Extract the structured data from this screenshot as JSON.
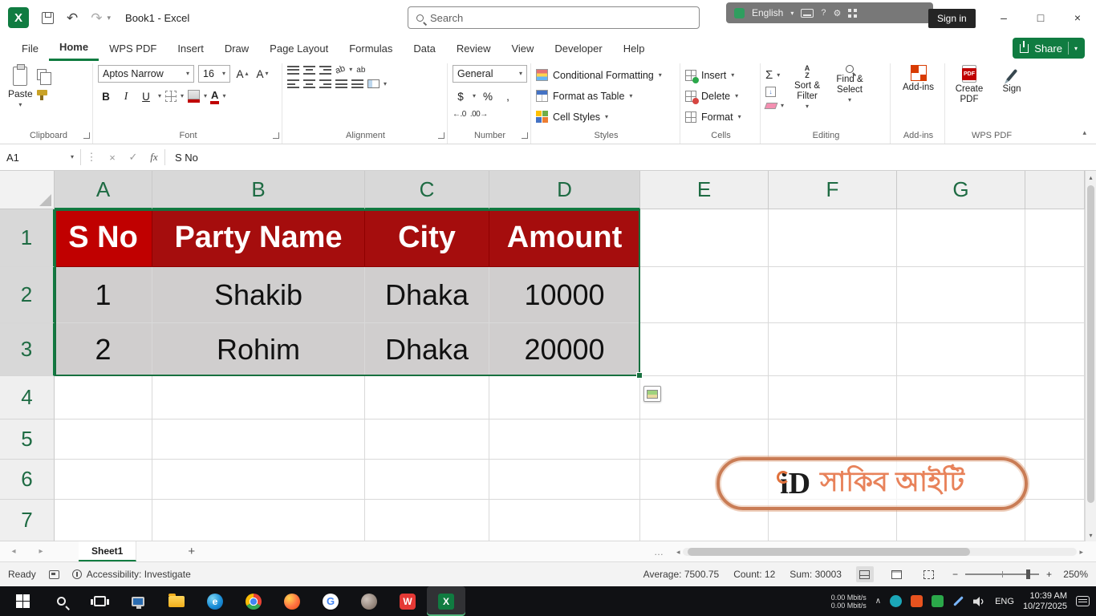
{
  "titlebar": {
    "app_title": "Book1 - Excel",
    "search_placeholder": "Search",
    "sign_in_label": "Sign in",
    "language_label": "English"
  },
  "icons": {
    "excel_logo": "X",
    "wps_logo": "W",
    "google_logo": "G",
    "edge_logo": "e",
    "dropdown": "▾",
    "undo": "↶",
    "redo": "↷",
    "minimize": "–",
    "maximize": "□",
    "close": "×",
    "sum": "Σ",
    "currency": "$",
    "percent": "%",
    "comma": ",",
    "letter_a": "A",
    "letter_z": "Z",
    "arrow_down": "↓",
    "check": "✓",
    "cancel": "×",
    "kebab": "⋮",
    "ellipsis": "…",
    "nav_left": "◂",
    "nav_right": "▸",
    "scroll_up": "▴",
    "scroll_down": "▾",
    "zoom_in": "+",
    "zoom_out": "−",
    "help": "?",
    "gear": "⚙",
    "tray_chevron": "∧",
    "inc_decimal": "←.0",
    "dec_decimal": ".00→",
    "pdf_label": "PDF",
    "plus": "+",
    "ab": "ab"
  },
  "ribbon_tabs": {
    "file": "File",
    "home": "Home",
    "wps_pdf": "WPS PDF",
    "insert": "Insert",
    "draw": "Draw",
    "page_layout": "Page Layout",
    "formulas": "Formulas",
    "data": "Data",
    "review": "Review",
    "view": "View",
    "developer": "Developer",
    "help": "Help",
    "share": "Share"
  },
  "ribbon": {
    "clipboard": {
      "paste": "Paste",
      "group": "Clipboard"
    },
    "font": {
      "family": "Aptos Narrow",
      "size": "16",
      "bold": "B",
      "italic": "I",
      "underline": "U",
      "group": "Font"
    },
    "alignment": {
      "group": "Alignment"
    },
    "number": {
      "format": "General",
      "group": "Number"
    },
    "styles": {
      "conditional_formatting": "Conditional Formatting",
      "format_as_table": "Format as Table",
      "cell_styles": "Cell Styles",
      "group": "Styles"
    },
    "cells": {
      "insert": "Insert",
      "delete": "Delete",
      "format": "Format",
      "group": "Cells"
    },
    "editing": {
      "sort_filter": "Sort & Filter",
      "find_select": "Find & Select",
      "group": "Editing"
    },
    "addins": {
      "label": "Add-ins",
      "group": "Add-ins"
    },
    "wps": {
      "create_pdf": "Create PDF",
      "sign": "Sign",
      "group": "WPS PDF"
    }
  },
  "formula_bar": {
    "name_box": "A1",
    "fx": "fx",
    "content": "S No"
  },
  "sheet": {
    "columns": [
      "A",
      "B",
      "C",
      "D",
      "E",
      "F",
      "G"
    ],
    "rows": [
      "1",
      "2",
      "3",
      "4",
      "5",
      "6",
      "7"
    ],
    "cells": {
      "header": [
        "S No",
        "Party Name",
        "City",
        "Amount"
      ],
      "r2": [
        "1",
        "Shakib",
        "Dhaka",
        "10000"
      ],
      "r3": [
        "2",
        "Rohim",
        "Dhaka",
        "20000"
      ]
    },
    "watermark_logo": "iD",
    "watermark_text": "সাকিব আইটি",
    "tab_name": "Sheet1"
  },
  "status_bar": {
    "mode": "Ready",
    "accessibility": "Accessibility: Investigate",
    "average": "Average: 7500.75",
    "count": "Count: 12",
    "sum": "Sum: 30003",
    "zoom": "250%"
  },
  "taskbar": {
    "net_up": "0.00 Mbit/s",
    "net_down": "0.00 Mbit/s",
    "language": "ENG",
    "time": "10:39 AM",
    "date": "10/27/2025"
  },
  "colors": {
    "excel_green": "#107C41",
    "header_red": "#C00000",
    "header_red_shaded": "#A50D0D",
    "selection_gray": "#D0CECE",
    "watermark_orange": "#E8825A"
  }
}
